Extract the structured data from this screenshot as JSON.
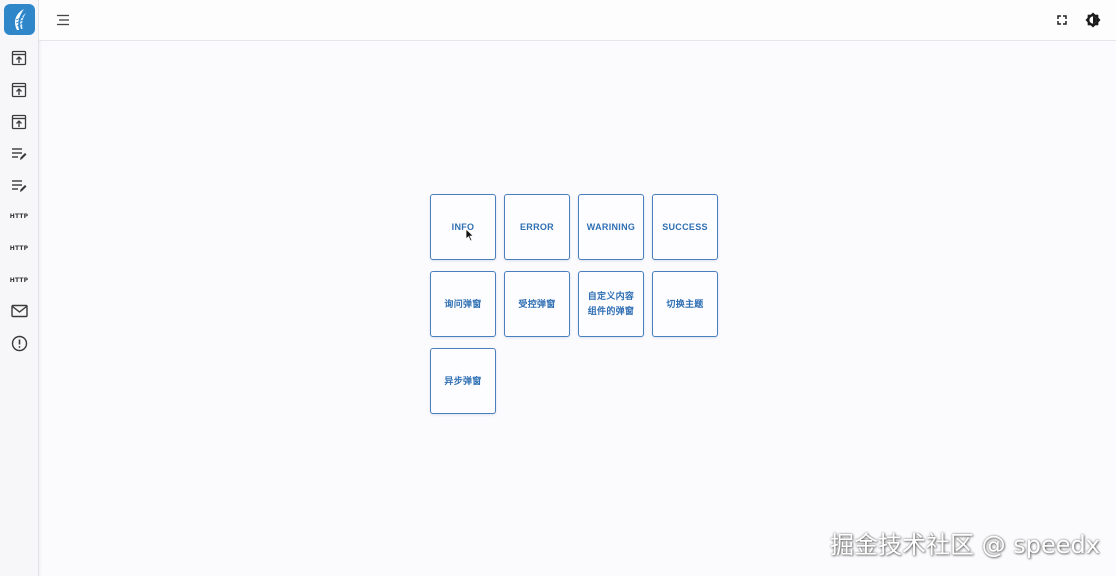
{
  "sidebar": {
    "items": [
      {
        "icon": "upload-window-icon"
      },
      {
        "icon": "upload-window-icon"
      },
      {
        "icon": "upload-window-icon"
      },
      {
        "icon": "edit-list-icon"
      },
      {
        "icon": "edit-list-icon"
      },
      {
        "icon": "http-icon",
        "label": "HTTP"
      },
      {
        "icon": "http-icon",
        "label": "HTTP"
      },
      {
        "icon": "http-icon",
        "label": "HTTP"
      },
      {
        "icon": "mail-icon"
      },
      {
        "icon": "alert-circle-icon"
      }
    ]
  },
  "header": {
    "menu_icon": "menu-icon",
    "fullscreen_icon": "fullscreen-icon",
    "theme_icon": "theme-toggle-icon"
  },
  "buttons": {
    "info": "INFO",
    "error": "ERROR",
    "warning": "WARINING",
    "success": "SUCCESS",
    "confirm": "询问弹窗",
    "controlled": "受控弹窗",
    "custom": "自定义内容\n组件的弹窗",
    "theme": "切换主题",
    "async": "异步弹窗"
  },
  "watermark": "掘金技术社区 @ speedx",
  "colors": {
    "accent": "#2f6fb3",
    "logo_bg": "#2f86c9",
    "tile_border": "#4a7fbf"
  }
}
